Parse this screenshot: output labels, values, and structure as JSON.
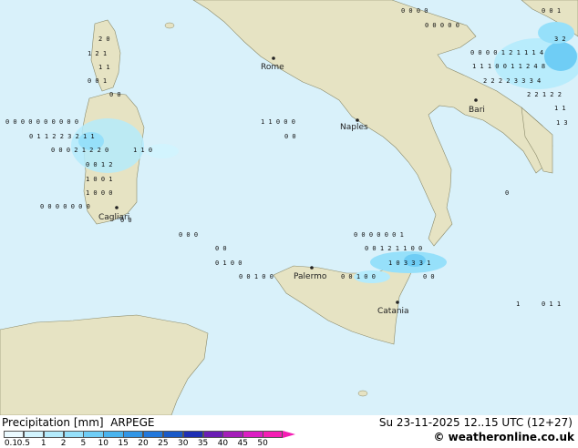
{
  "footer": {
    "title": "Precipitation [mm]",
    "model": "ARPEGE",
    "datetime": "Su 23-11-2025 12..15 UTC (12+27)",
    "credit": "© weatheronline.co.uk"
  },
  "legend": {
    "ticks": [
      "0.1",
      "0.5",
      "1",
      "2",
      "5",
      "10",
      "15",
      "20",
      "25",
      "30",
      "35",
      "40",
      "45",
      "50"
    ],
    "colors": [
      "#ebfaff",
      "#d2f4fe",
      "#b4ebfc",
      "#96e0fa",
      "#6fcdf5",
      "#4ab4ee",
      "#3296e6",
      "#2378dc",
      "#1a5ac8",
      "#1e2fb4",
      "#6a1eb4",
      "#a51eb9",
      "#dc1ec3",
      "#f51eb4"
    ]
  },
  "colors": {
    "sea": "#d9f1fa",
    "land": "#e8e5c9"
  },
  "cities": [
    {
      "name": "Rome"
    },
    {
      "name": "Naples"
    },
    {
      "name": "Bari"
    },
    {
      "name": "Cagliari"
    },
    {
      "name": "Palermo"
    },
    {
      "name": "Catania"
    }
  ],
  "values": {
    "nw1": "2 0",
    "nw2": "1 2 1",
    "nw3": "1 1",
    "nw4": "0 0 1",
    "nw5": "0 0",
    "sard1": "0 0 0 0 0 0 0 0 0 0",
    "sard2": "0 1 1 2 2 3 2 1 1",
    "sard3": "0 0 0 2 1 2 2 0",
    "sard4": "0 0 1 2",
    "sard5": "1 0 0 1",
    "sard6": "1 0 0 0",
    "sard7": "0 0 0 0 0 0 0",
    "sard8": "0 0",
    "tyr1": "1 1 0 0 0",
    "tyr2": "0 0",
    "tyr3": "1 1 0",
    "ne1": "0 0 0 0",
    "ne2": "0 0 0 0 0",
    "ne3": "0 0 0 0 1 2 1 1 1 4",
    "ne4": "1 1 1 0 0 1 1 2 4 8",
    "ne5": "2 2 2 2 3 3 3 4",
    "ne6": "2 2 1 2 2",
    "ne7": "1 1",
    "ne8": "1 3",
    "ne9": "3 2",
    "ne10": "0 0 1",
    "sic1": "0 0 0 0 0 0 1",
    "sic2": "0 0 1 2 1 1 0 0",
    "sic3": "1 0 3 3 3 1",
    "sic4": "0 0 1 0 0",
    "sic5": "0 1 0 0",
    "sic6": "0 0 1 0 0",
    "sic7": "0 0",
    "sic8": "0 0 0",
    "sic9": "0 0",
    "ion1": "1",
    "ion2": "0 1 1",
    "ion3": "0"
  }
}
